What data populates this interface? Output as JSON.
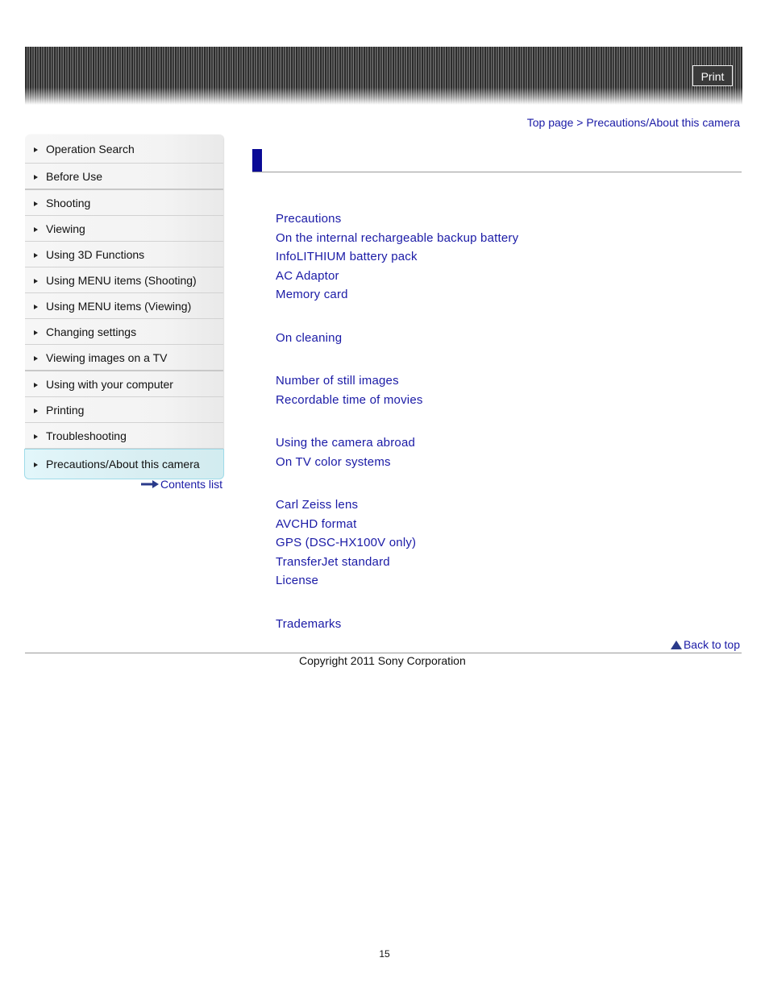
{
  "header": {
    "print_label": "Print"
  },
  "sidebar": {
    "items": [
      {
        "label": "Operation Search"
      },
      {
        "label": "Before Use"
      },
      {
        "label": "Shooting"
      },
      {
        "label": "Viewing"
      },
      {
        "label": "Using 3D Functions"
      },
      {
        "label": "Using MENU items (Shooting)"
      },
      {
        "label": "Using MENU items (Viewing)"
      },
      {
        "label": "Changing settings"
      },
      {
        "label": "Viewing images on a TV"
      },
      {
        "label": "Using with your computer"
      },
      {
        "label": "Printing"
      },
      {
        "label": "Troubleshooting"
      },
      {
        "label": "Precautions/About this camera",
        "active": true
      }
    ],
    "contents_list_label": "Contents list"
  },
  "breadcrumb": {
    "top_page": "Top page",
    "separator": ">",
    "current": "Precautions/About this camera"
  },
  "main": {
    "groups": [
      {
        "links": [
          "Precautions",
          "On the internal rechargeable backup battery",
          "InfoLITHIUM battery pack",
          "AC Adaptor",
          "Memory card"
        ]
      },
      {
        "links": [
          "On cleaning"
        ]
      },
      {
        "links": [
          "Number of still images",
          "Recordable time of movies"
        ]
      },
      {
        "links": [
          "Using the camera abroad",
          "On TV color systems"
        ]
      },
      {
        "links": [
          "Carl Zeiss lens",
          "AVCHD format",
          "GPS (DSC-HX100V only)",
          "TransferJet standard",
          "License"
        ]
      },
      {
        "links": [
          "Trademarks"
        ]
      }
    ]
  },
  "footer": {
    "back_to_top": "Back to top",
    "copyright": "Copyright 2011 Sony Corporation",
    "page_number": "15"
  },
  "colors": {
    "link": "#1a1aa6",
    "title_bar": "#0a0a96",
    "active_nav": "#d8eef2"
  }
}
